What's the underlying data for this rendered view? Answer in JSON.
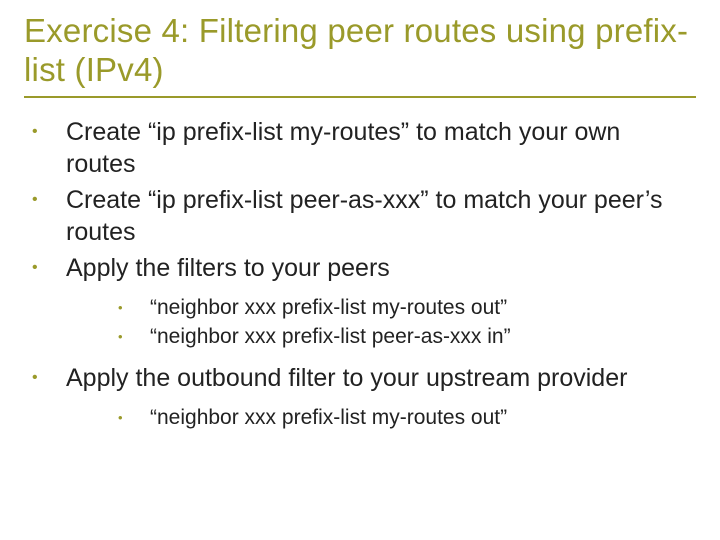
{
  "title": "Exercise 4: Filtering peer routes using prefix-list (IPv4)",
  "bullets": [
    {
      "text": "Create  “ip prefix-list my-routes” to match your own routes"
    },
    {
      "text": "Create “ip prefix-list peer-as-xxx” to match your peer’s routes"
    },
    {
      "text": "Apply the filters to your peers",
      "sub": [
        "“neighbor xxx prefix-list my-routes out”",
        "“neighbor xxx prefix-list peer-as-xxx in”"
      ]
    },
    {
      "text": "Apply the outbound filter to your upstream provider",
      "sub": [
        "“neighbor xxx prefix-list my-routes out”"
      ]
    }
  ]
}
